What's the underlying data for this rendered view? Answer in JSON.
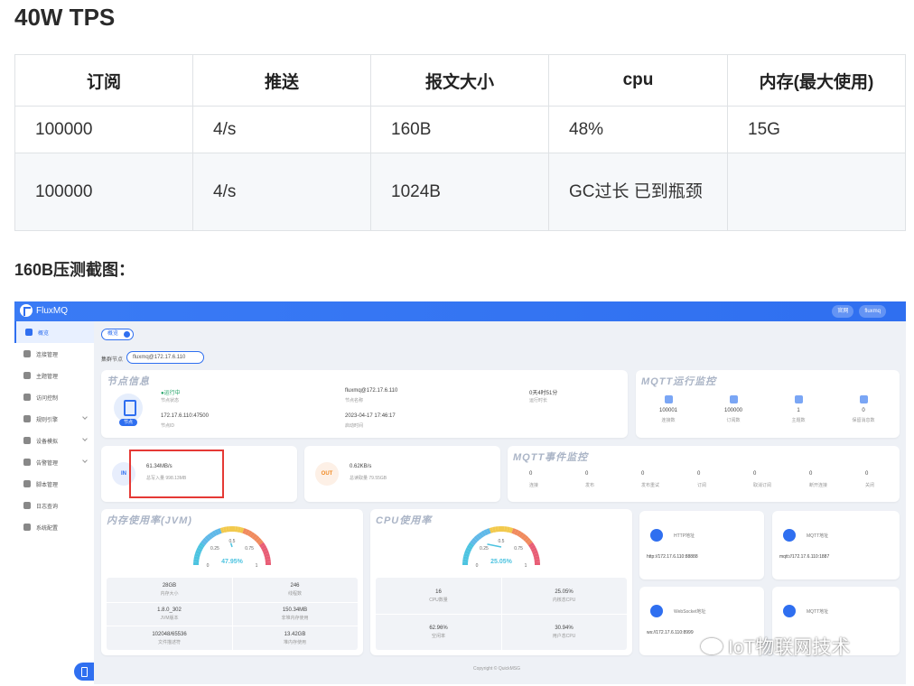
{
  "doc": {
    "title": "40W TPS",
    "caption": "160B压测截图："
  },
  "table": {
    "headers": [
      "订阅",
      "推送",
      "报文大小",
      "cpu",
      "内存(最大使用)"
    ],
    "rows": [
      [
        "100000",
        "4/s",
        "160B",
        "48%",
        "15G"
      ],
      [
        "100000",
        "4/s",
        "1024B",
        "GC过长 已到瓶颈",
        ""
      ]
    ]
  },
  "screenshot": {
    "app_name": "FluxMQ",
    "top_right": [
      "官网",
      "fluxmq"
    ],
    "sidebar": [
      {
        "label": "概览",
        "active": true,
        "arrow": false
      },
      {
        "label": "连接管理",
        "active": false,
        "arrow": false
      },
      {
        "label": "主题管理",
        "active": false,
        "arrow": false
      },
      {
        "label": "访问控制",
        "active": false,
        "arrow": false
      },
      {
        "label": "规则引擎",
        "active": false,
        "arrow": true
      },
      {
        "label": "设备模拟",
        "active": false,
        "arrow": true
      },
      {
        "label": "告警管理",
        "active": false,
        "arrow": true
      },
      {
        "label": "脚本管理",
        "active": false,
        "arrow": false
      },
      {
        "label": "日志查询",
        "active": false,
        "arrow": false
      },
      {
        "label": "系统配置",
        "active": false,
        "arrow": false
      }
    ],
    "tab": "概览",
    "node_select_label": "集群节点",
    "node_select_value": "fluxmq@172.17.6.110",
    "node_info": {
      "title": "节点信息",
      "badge": "节点",
      "status": "●运行中",
      "status_label": "节点状态",
      "node_name": "fluxmq@172.17.6.110",
      "node_name_label": "节点名称",
      "uptime": "0天4时51分",
      "uptime_label": "运行时长",
      "node_id": "172.17.6.110:47500",
      "node_id_label": "节点ID",
      "start_time": "2023-04-17 17:46:17",
      "start_time_label": "启动时间"
    },
    "mqtt_run": {
      "title": "MQTT运行监控",
      "items": [
        {
          "value": "100001",
          "label": "连接数"
        },
        {
          "value": "100000",
          "label": "订阅数"
        },
        {
          "value": "1",
          "label": "主题数"
        },
        {
          "value": "0",
          "label": "保留消息数"
        }
      ]
    },
    "in_card": {
      "icon": "IN",
      "rate": "61.34MB/s",
      "total": "总写入量 998.13MB"
    },
    "out_card": {
      "icon": "OUT",
      "rate": "0.62KB/s",
      "total": "总读取量 79.55GB"
    },
    "mqtt_event": {
      "title": "MQTT事件监控",
      "items": [
        {
          "value": "0",
          "label": "连接"
        },
        {
          "value": "0",
          "label": "发布"
        },
        {
          "value": "0",
          "label": "发布重试"
        },
        {
          "value": "0",
          "label": "订阅"
        },
        {
          "value": "0",
          "label": "取消订阅"
        },
        {
          "value": "0",
          "label": "断开连接"
        },
        {
          "value": "0",
          "label": "关闭"
        }
      ]
    },
    "jvm": {
      "title": "内存使用率(JVM)",
      "percent": "47.95%",
      "level": 0.4795,
      "ticks": [
        "0",
        "0.25",
        "0.5",
        "0.75",
        "1"
      ],
      "cells": [
        {
          "value": "28GB",
          "label": "内存大小"
        },
        {
          "value": "246",
          "label": "线程数"
        },
        {
          "value": "1.8.0_302",
          "label": "JVM版本"
        },
        {
          "value": "150.34MB",
          "label": "非堆内存使用"
        },
        {
          "value": "102048/65536",
          "label": "文件描述符"
        },
        {
          "value": "13.42GB",
          "label": "堆内存使用"
        }
      ]
    },
    "cpu": {
      "title": "CPU使用率",
      "percent": "25.05%",
      "level": 0.2505,
      "ticks": [
        "0",
        "0.25",
        "0.5",
        "0.75",
        "1"
      ],
      "cells": [
        {
          "value": "16",
          "label": "CPU数量"
        },
        {
          "value": "25.05%",
          "label": "内核态CPU"
        },
        {
          "value": "62.96%",
          "label": "空闲率"
        },
        {
          "value": "30.94%",
          "label": "用户态CPU"
        }
      ]
    },
    "services": [
      {
        "title": "HTTP地址",
        "value": "http://172.17.6.110:88888"
      },
      {
        "title": "MQTT地址",
        "value": "mqtt://172.17.6.110:1887"
      },
      {
        "title": "WebSocket地址",
        "value": "ws://172.17.6.110:8999"
      },
      {
        "title": "MQTT地址",
        "value": ""
      }
    ],
    "footer": "Copyright © QuickMSG",
    "watermark": "IoT物联网技术"
  }
}
